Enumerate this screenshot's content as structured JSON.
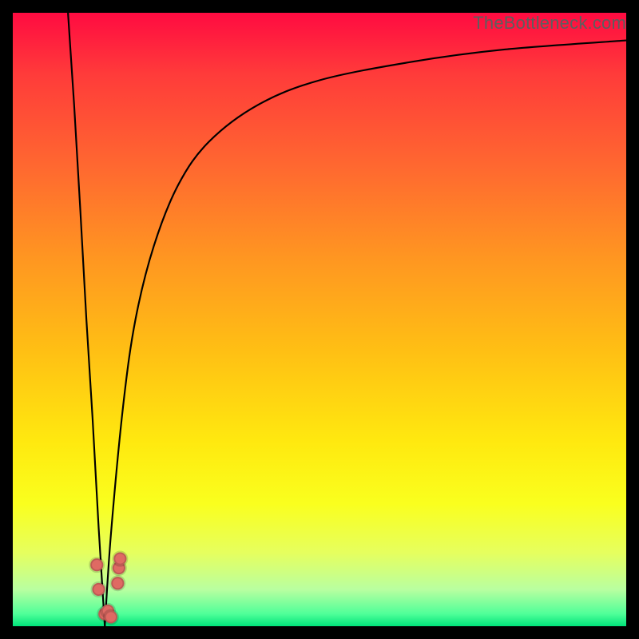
{
  "watermark": "TheBottleneck.com",
  "colors": {
    "background": "#000000",
    "gradient_top": "#ff0b41",
    "gradient_bottom": "#00e37a",
    "curve": "#000000",
    "dots": "#df6a63"
  },
  "chart_data": {
    "type": "line",
    "title": "",
    "xlabel": "",
    "ylabel": "",
    "xlim": [
      0,
      100
    ],
    "ylim": [
      0,
      100
    ],
    "grid": false,
    "legend": false,
    "description": "V-shaped bottleneck curve with asymptotic rise on the right branch; minimum at approximately x≈15, y≈0; clustered data points near the minimum.",
    "series": [
      {
        "name": "curve-left",
        "x": [
          9,
          10,
          11,
          12,
          13,
          14,
          15
        ],
        "values": [
          100,
          85,
          68,
          50,
          34,
          16,
          0
        ]
      },
      {
        "name": "curve-right",
        "x": [
          15,
          16,
          18,
          20,
          23,
          27,
          32,
          40,
          50,
          65,
          80,
          100
        ],
        "values": [
          0,
          15,
          36,
          50,
          62,
          72,
          79,
          85,
          89,
          92,
          94,
          95.5
        ]
      }
    ],
    "points": [
      {
        "x": 13.7,
        "y": 10
      },
      {
        "x": 14.0,
        "y": 6
      },
      {
        "x": 15.0,
        "y": 2
      },
      {
        "x": 15.5,
        "y": 2.5
      },
      {
        "x": 16.0,
        "y": 1.5
      },
      {
        "x": 17.3,
        "y": 9.5
      },
      {
        "x": 17.1,
        "y": 7
      },
      {
        "x": 17.5,
        "y": 11
      }
    ]
  }
}
